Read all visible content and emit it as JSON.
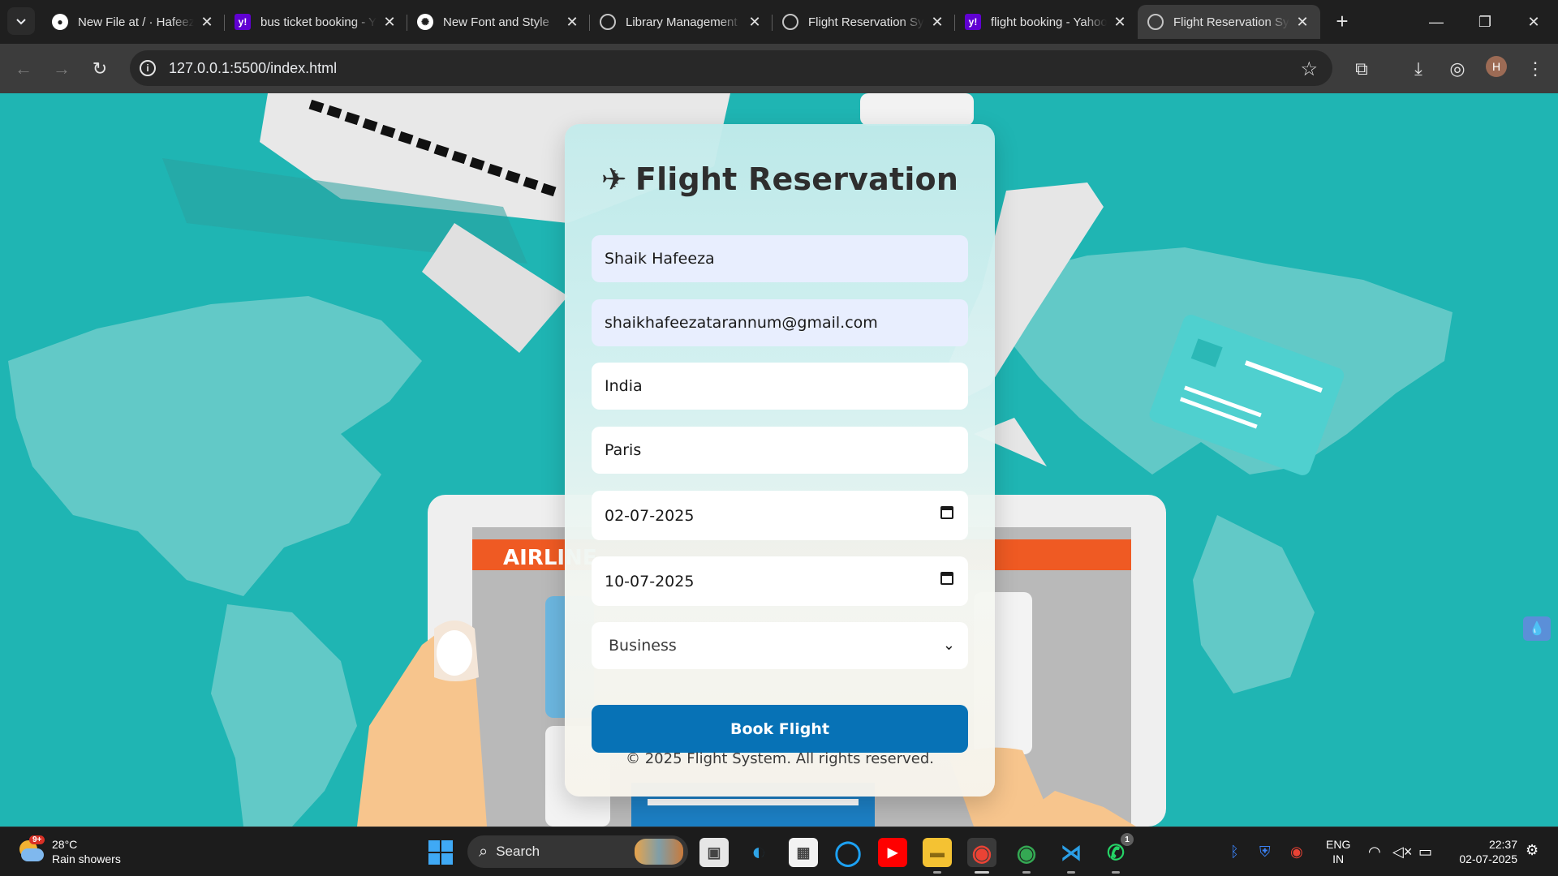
{
  "browser": {
    "tabs": [
      {
        "title": "New File at / · Hafeeza",
        "favicon": "github-icon"
      },
      {
        "title": "bus ticket booking - Yahoo",
        "favicon": "yahoo-icon"
      },
      {
        "title": "New Font and Style",
        "favicon": "openai-icon"
      },
      {
        "title": "Library Management",
        "favicon": "globe-icon"
      },
      {
        "title": "Flight Reservation System",
        "favicon": "globe-icon"
      },
      {
        "title": "flight booking - Yahoo",
        "favicon": "yahoo-icon"
      },
      {
        "title": "Flight Reservation System",
        "favicon": "globe-icon",
        "active": true
      }
    ],
    "url": "127.0.0.1:5500/index.html",
    "profile_initial": "H"
  },
  "page": {
    "background_art": {
      "screen_banner": "AIRLINE"
    },
    "form": {
      "title": "Flight Reservation",
      "title_icon": "airplane-icon",
      "name": "Shaik Hafeeza",
      "email": "shaikhafeezatarannum@gmail.com",
      "from": "India",
      "to": "Paris",
      "departure_date": "02-07-2025",
      "return_date": "10-07-2025",
      "class": "Business",
      "submit_label": "Book Flight",
      "footer": "© 2025 Flight System. All rights reserved."
    },
    "colors": {
      "background": "#1fb5b3",
      "button": "#0772b6"
    }
  },
  "taskbar": {
    "weather": {
      "temp": "28°C",
      "desc": "Rain showers",
      "badge": "9+"
    },
    "search_label": "Search",
    "lang_top": "ENG",
    "lang_bottom": "IN",
    "time": "22:37",
    "date": "02-07-2025",
    "whatsapp_badge": "1"
  }
}
